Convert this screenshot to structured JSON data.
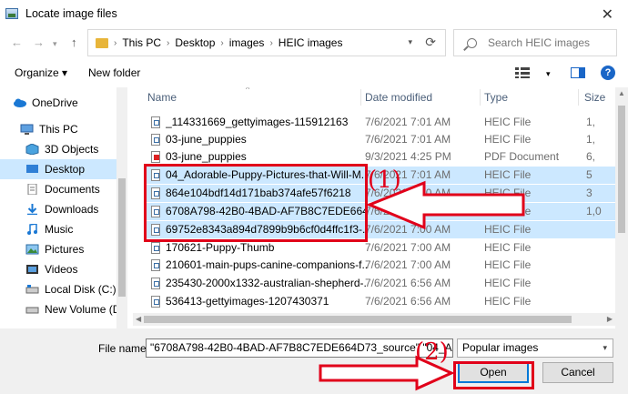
{
  "window": {
    "title": "Locate image files"
  },
  "address": {
    "crumbs": [
      "This PC",
      "Desktop",
      "images",
      "HEIC images"
    ],
    "search_placeholder": "Search HEIC images"
  },
  "toolbar": {
    "organize": "Organize ▾",
    "new_folder": "New folder",
    "help": "?"
  },
  "sidebar": {
    "items": [
      {
        "label": "OneDrive",
        "icon": "cloud-icon"
      },
      {
        "label": "This PC",
        "icon": "computer-icon"
      },
      {
        "label": "3D Objects",
        "icon": "cube-icon"
      },
      {
        "label": "Desktop",
        "icon": "desktop-icon"
      },
      {
        "label": "Documents",
        "icon": "documents-icon"
      },
      {
        "label": "Downloads",
        "icon": "download-icon"
      },
      {
        "label": "Music",
        "icon": "music-icon"
      },
      {
        "label": "Pictures",
        "icon": "pictures-icon"
      },
      {
        "label": "Videos",
        "icon": "videos-icon"
      },
      {
        "label": "Local Disk (C:)",
        "icon": "disk-icon"
      },
      {
        "label": "New Volume (D:",
        "icon": "drive-icon"
      }
    ]
  },
  "columns": {
    "name": "Name",
    "date": "Date modified",
    "type": "Type",
    "size": "Size"
  },
  "files": [
    {
      "name": "_114331669_gettyimages-115912163",
      "date": "7/6/2021 7:01 AM",
      "type": "HEIC File",
      "size": "1,"
    },
    {
      "name": "03-june_puppies",
      "date": "7/6/2021 7:01 AM",
      "type": "HEIC File",
      "size": "1,"
    },
    {
      "name": "03-june_puppies",
      "date": "9/3/2021 4:25 PM",
      "type": "PDF Document",
      "size": "6,"
    },
    {
      "name": "04_Adorable-Puppy-Pictures-that-Will-M...",
      "date": "7/6/2021 7:01 AM",
      "type": "HEIC File",
      "size": "5"
    },
    {
      "name": "864e104bdf14d171bab374afe57f6218",
      "date": "7/6/2021 7:00 AM",
      "type": "HEIC File",
      "size": "3"
    },
    {
      "name": "6708A798-42B0-4BAD-AF7B8C7EDE664...",
      "date": "7/6/2021 7:00 AM",
      "type": "HEIC File",
      "size": "1,0"
    },
    {
      "name": "69752e8343a894d7899b9b6cf0d4ffc1f3-...",
      "date": "7/6/2021 7:00 AM",
      "type": "HEIC File",
      "size": ""
    },
    {
      "name": "170621-Puppy-Thumb",
      "date": "7/6/2021 7:00 AM",
      "type": "HEIC File",
      "size": ""
    },
    {
      "name": "210601-main-pups-canine-companions-f...",
      "date": "7/6/2021 7:00 AM",
      "type": "HEIC File",
      "size": ""
    },
    {
      "name": "235430-2000x1332-australian-shepherd-...",
      "date": "7/6/2021 6:56 AM",
      "type": "HEIC File",
      "size": ""
    },
    {
      "name": "536413-gettyimages-1207430371",
      "date": "7/6/2021 6:56 AM",
      "type": "HEIC File",
      "size": ""
    }
  ],
  "bottom": {
    "file_name_label": "File name:",
    "file_name_value": "\"6708A798-42B0-4BAD-AF7B8C7EDE664D73_source\" \"04_Adora",
    "filter_value": "Popular images",
    "open_label": "Open",
    "cancel_label": "Cancel"
  },
  "annotations": {
    "step1": "(1)",
    "step2": "(2)"
  },
  "colors": {
    "selection": "#cce8ff",
    "annotation": "#e1001a",
    "accent": "#0078d7"
  }
}
